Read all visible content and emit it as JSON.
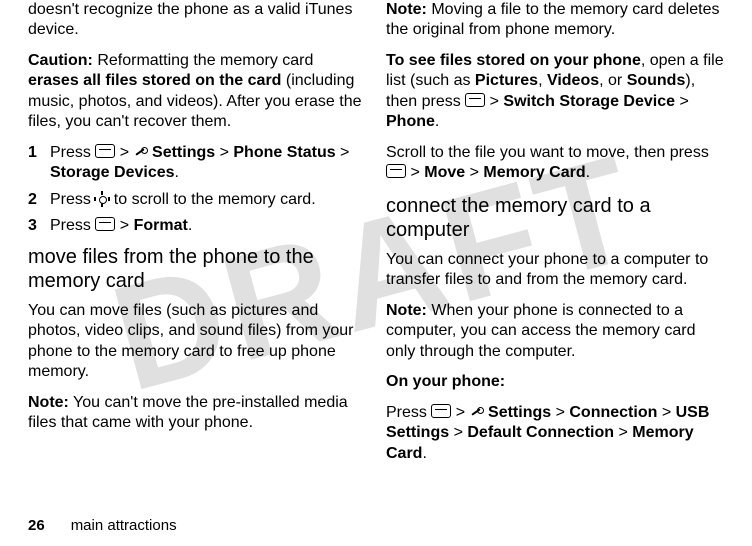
{
  "watermark": "DRAFT",
  "left": {
    "p1a": "doesn't recognize the phone as a valid iTunes device.",
    "caution_label": "Caution:",
    "caution_p1": " Reformatting the memory card ",
    "caution_bold": "erases all files stored on the card",
    "caution_p2": " (including music, photos, and videos). After you erase the files, you can't recover them.",
    "steps": {
      "s1_pre": "Press ",
      "s1_mid1": " > ",
      "s1_settings": " Settings",
      "s1_mid2": " > ",
      "s1_phone_status": "Phone Status",
      "s1_mid3": " > ",
      "s1_storage": "Storage Devices",
      "s1_end": ".",
      "s2_pre": "Press ",
      "s2_post": " to scroll to the memory card.",
      "s3_pre": "Press ",
      "s3_mid": " > ",
      "s3_format": "Format",
      "s3_end": "."
    },
    "h_move": "move files from the phone to the memory card",
    "p_move": "You can move files (such as pictures and photos, video clips, and sound files) from your phone to the memory card to free up phone memory.",
    "note_label": "Note:",
    "note_move": " You can't move the pre-installed media files that came with your phone."
  },
  "right": {
    "note_label": "Note:",
    "note_del": " Moving a file to the memory card deletes the original from phone memory.",
    "see_bold": "To see files stored on your phone",
    "see_p1": ", open a file list (such as ",
    "pictures": "Pictures",
    "comma1": ", ",
    "videos": "Videos",
    "comma2": ", or ",
    "sounds": "Sounds",
    "see_p2": "), then press ",
    "see_mid1": " > ",
    "switch": "Switch Storage Device",
    "see_mid2": " > ",
    "phone": "Phone",
    "see_end": ".",
    "scroll_p1": "Scroll to the file you want to move, then press ",
    "scroll_mid1": " > ",
    "move": "Move",
    "scroll_mid2": " > ",
    "memcard": "Memory Card",
    "scroll_end": ".",
    "h_conn": "connect the memory card to a computer",
    "p_conn": "You can connect your phone to a computer to transfer files to and from the memory card.",
    "note2": " When your phone is connected to a computer, you can access the memory card only through the computer.",
    "onphone": "On your phone:",
    "press_pre": "Press ",
    "press_mid1": " > ",
    "settings": " Settings",
    "press_mid2": " > ",
    "connection": "Connection",
    "press_mid3": " > ",
    "usb": "USB Settings",
    "press_mid4": " > ",
    "defconn": "Default Connection",
    "press_mid5": " > ",
    "memcard2": "Memory Card",
    "press_end": "."
  },
  "footer": {
    "page": "26",
    "section": "main attractions"
  }
}
